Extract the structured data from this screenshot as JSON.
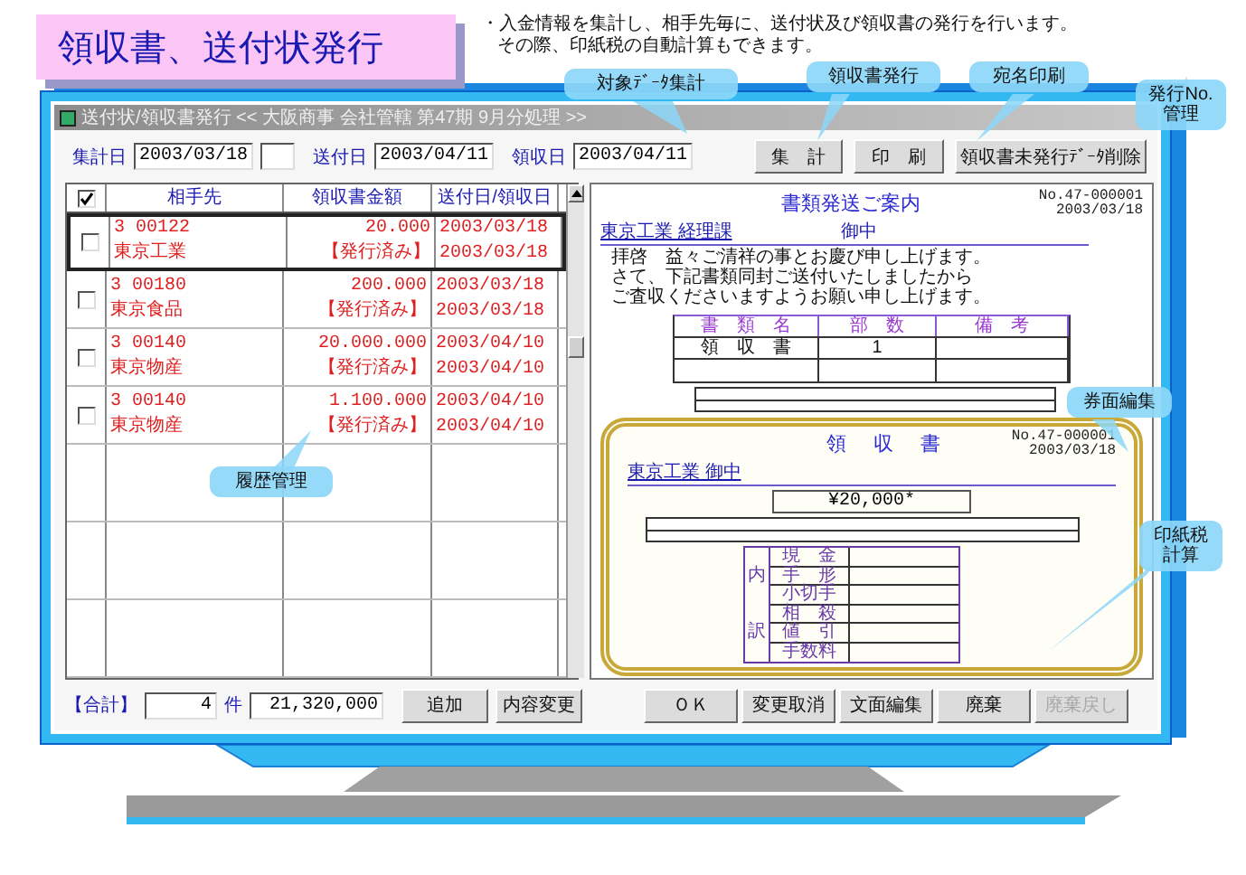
{
  "heading": "領収書、送付状発行",
  "description": [
    "・入金情報を集計し、相手先毎に、送付状及び領収書の発行を行います。",
    "その際、印紙税の自動計算もできます。"
  ],
  "callouts": [
    "対象ﾃﾞｰﾀ集計",
    "領収書発行",
    "宛名印刷",
    "発行No.管理",
    "券面編集",
    "印紙税計算",
    "履歴管理"
  ],
  "window": {
    "title": "送付状/領収書発行 << 大阪商事 会社管轄 第47期 9月分処理 >>"
  },
  "toolbar": {
    "fields": [
      {
        "label": "集計日",
        "value": "2003/03/18"
      },
      {
        "label": "送付日",
        "value": "2003/04/11"
      },
      {
        "label": "領収日",
        "value": "2003/04/11"
      }
    ],
    "buttons": [
      "集　計",
      "印　刷",
      "領収書未発行ﾃﾞｰﾀ削除"
    ]
  },
  "table": {
    "header_checked": true,
    "columns": [
      "相手先",
      "領収書金額",
      "送付日/領収日"
    ],
    "rows": [
      {
        "code": "3 00122",
        "name": "東京工業",
        "amount": "20.000",
        "status": "【発行済み】",
        "sent": "2003/03/18",
        "received": "2003/03/18",
        "checked": false,
        "selected": true
      },
      {
        "code": "3 00180",
        "name": "東京食品",
        "amount": "200.000",
        "status": "【発行済み】",
        "sent": "2003/03/18",
        "received": "2003/03/18",
        "checked": false,
        "selected": false
      },
      {
        "code": "3 00140",
        "name": "東京物産",
        "amount": "20.000.000",
        "status": "【発行済み】",
        "sent": "2003/04/10",
        "received": "2003/04/10",
        "checked": false,
        "selected": false
      },
      {
        "code": "3 00140",
        "name": "東京物産",
        "amount": "1.100.000",
        "status": "【発行済み】",
        "sent": "2003/04/10",
        "received": "2003/04/10",
        "checked": false,
        "selected": false
      }
    ]
  },
  "totals": {
    "label": "【合計】",
    "count": "4",
    "unit": "件",
    "amount": "21,320,000",
    "buttons": [
      "追加",
      "内容変更"
    ]
  },
  "letter": {
    "title": "書類発送ご案内",
    "number": "No.47-000001",
    "date": "2003/03/18",
    "addressee": "東京工業 経理課",
    "honorific": "御中",
    "body": [
      "拝啓　益々ご清祥の事とお慶び申し上げます。",
      "さて、下記書類同封ご送付いたしましたから",
      "ご査収くださいますようお願い申し上げます。"
    ],
    "columns": [
      "書　類　名",
      "部　数",
      "備　考"
    ],
    "rows": [
      {
        "name": "領　収　書",
        "count": "1"
      }
    ]
  },
  "receipt": {
    "title": "領　収　書",
    "number": "No.47-000001",
    "date": "2003/03/18",
    "addressee": "東京工業 御中",
    "amount": "¥20,000*",
    "breakdown_label": [
      "内",
      "訳"
    ],
    "breakdown": [
      "現　金",
      "手　形",
      "小切手",
      "相　殺",
      "値　引",
      "手数料"
    ]
  },
  "footer_buttons": [
    {
      "label": "ＯＫ",
      "disabled": false
    },
    {
      "label": "変更取消",
      "disabled": false
    },
    {
      "label": "文面編集",
      "disabled": false
    },
    {
      "label": "廃棄",
      "disabled": false
    },
    {
      "label": "廃棄戻し",
      "disabled": true
    }
  ]
}
